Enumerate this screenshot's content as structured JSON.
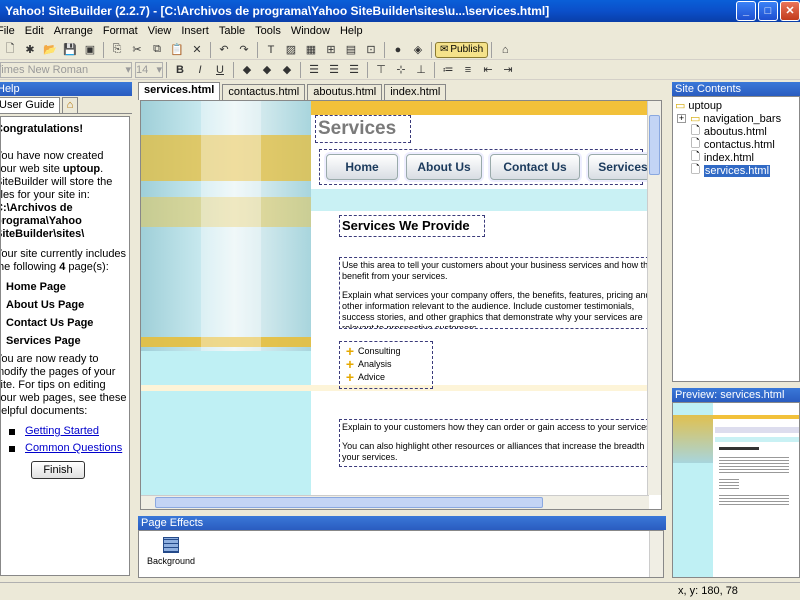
{
  "window": {
    "title": "Yahoo! SiteBuilder (2.2.7) - [C:\\Archivos de programa\\Yahoo SiteBuilder\\sites\\u...\\services.html]",
    "controls": [
      "minimize",
      "maximize",
      "close"
    ]
  },
  "menu": [
    "File",
    "Edit",
    "Arrange",
    "Format",
    "View",
    "Insert",
    "Table",
    "Tools",
    "Window",
    "Help"
  ],
  "toolbar": {
    "publish_label": "Publish",
    "font_name": "Times New Roman",
    "font_size": "14"
  },
  "left_panel": {
    "header": "Help",
    "tab": "User Guide",
    "title": "Congratulations!",
    "p1_a": "You have now created your web site ",
    "p1_site": "uptoup",
    "p1_b": ". SiteBuilder will store the files for your site in: ",
    "p1_path": "C:\\Archivos de programa\\Yahoo SiteBuilder\\sites\\",
    "p2_a": "Your site currently includes the following ",
    "p2_count": "4",
    "p2_b": " page(s):",
    "pages": [
      "Home Page",
      "About Us Page",
      "Contact Us Page",
      "Services Page"
    ],
    "p3": "You are now ready to modify the pages of your site. For tips on editing your web pages, see these helpful documents:",
    "links": [
      "Getting Started",
      "Common Questions"
    ],
    "finish_label": "Finish"
  },
  "editor": {
    "tabs": [
      "services.html",
      "contactus.html",
      "aboutus.html",
      "index.html"
    ],
    "active_tab": 0,
    "page": {
      "title": "Services",
      "nav": [
        "Home",
        "About Us",
        "Contact Us",
        "Services"
      ],
      "heading": "Services We Provide",
      "para1": "Use this area to tell your customers about your business services and how they benefit from your services.",
      "para2": "Explain what services your company offers, the benefits, features, pricing and other information relevant to the audience. Include customer testimonials, success stories, and other graphics that demonstrate why your services are relevant to prospective customers.",
      "list": [
        "Consulting",
        "Analysis",
        "Advice"
      ],
      "para3": "Explain to your customers how they can order or gain access to your services.",
      "para4": "You can also highlight other resources or alliances that increase the breadth of your services."
    }
  },
  "page_effects": {
    "header": "Page Effects",
    "items": [
      {
        "label": "Background",
        "icon": "grid-icon"
      }
    ]
  },
  "site_contents": {
    "header": "Site Contents",
    "root": "uptoup",
    "items": [
      {
        "label": "navigation_bars",
        "type": "folder"
      },
      {
        "label": "aboutus.html",
        "type": "file"
      },
      {
        "label": "contactus.html",
        "type": "file"
      },
      {
        "label": "index.html",
        "type": "file"
      },
      {
        "label": "services.html",
        "type": "file",
        "selected": true
      }
    ]
  },
  "preview": {
    "header": "Preview: services.html"
  },
  "status": {
    "coords": "x, y: 180, 78"
  }
}
